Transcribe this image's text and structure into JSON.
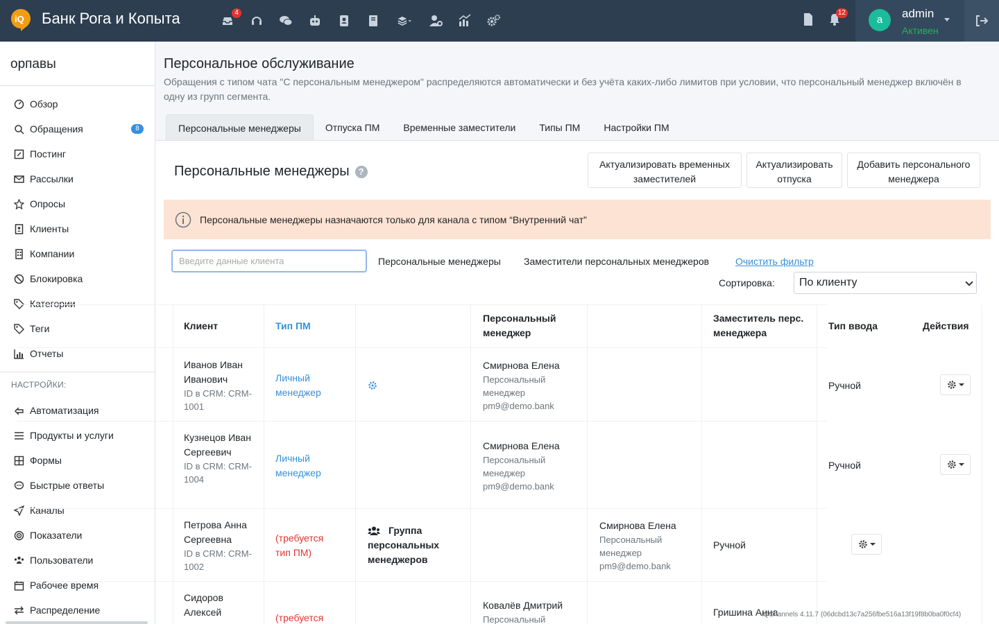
{
  "header": {
    "brand": "Банк Рога и Копыта",
    "inbox_badge": "4",
    "notif_badge": "12",
    "user": {
      "avatar_letter": "a",
      "name": "admin",
      "status": "Активен"
    }
  },
  "sidebar": {
    "title": "орпавы",
    "items": [
      {
        "label": "Обзор",
        "icon": "dashboard-icon"
      },
      {
        "label": "Обращения",
        "icon": "search-icon",
        "badge": "8"
      },
      {
        "label": "Постинг",
        "icon": "edit-icon"
      },
      {
        "label": "Рассылки",
        "icon": "envelope-icon"
      },
      {
        "label": "Опросы",
        "icon": "star-icon"
      },
      {
        "label": "Клиенты",
        "icon": "contact-book-icon"
      },
      {
        "label": "Компании",
        "icon": "building-icon"
      },
      {
        "label": "Блокировка",
        "icon": "ban-icon"
      },
      {
        "label": "Категории",
        "icon": "tags-icon"
      },
      {
        "label": "Теги",
        "icon": "tag-icon"
      },
      {
        "label": "Отчеты",
        "icon": "chart-icon"
      }
    ],
    "settings_title": "НАСТРОЙКИ:",
    "settings": [
      {
        "label": "Автоматизация",
        "icon": "automation-icon"
      },
      {
        "label": "Продукты и услуги",
        "icon": "list-icon"
      },
      {
        "label": "Формы",
        "icon": "table-icon"
      },
      {
        "label": "Быстрые ответы",
        "icon": "comment-icon"
      },
      {
        "label": "Каналы",
        "icon": "send-icon"
      },
      {
        "label": "Показатели",
        "icon": "target-icon"
      },
      {
        "label": "Пользователи",
        "icon": "users-icon"
      },
      {
        "label": "Рабочее время",
        "icon": "calendar-icon"
      },
      {
        "label": "Распределение",
        "icon": "exchange-icon"
      }
    ]
  },
  "page": {
    "title": "Персональное обслуживание",
    "description": "Обращения с типом чата \"С персональным менеджером\" распределяются автоматически и без учёта каких-либо лимитов при условии, что персональный менеджер включён в одну из групп сегмента.",
    "tabs": [
      "Персональные менеджеры",
      "Отпуска ПМ",
      "Временные заместители",
      "Типы ПМ",
      "Настройки ПМ"
    ],
    "card_title": "Персональные менеджеры",
    "buttons": {
      "update_deputies": "Актуализировать временных заместителей",
      "update_vacations": "Актуализировать отпуска",
      "add_manager": "Добавить персонального менеджера"
    },
    "alert": "Персональные менеджеры назначаются только для канала с типом “Внутренний чат”",
    "search_placeholder": "Введите данные клиента",
    "filters": {
      "managers": "Персональные менеджеры",
      "deputies": "Заместители персональных менеджеров",
      "clear": "Очистить фильтр"
    },
    "sort_label": "Сортировка:",
    "sort_value": "По клиенту"
  },
  "table": {
    "headers": {
      "client": "Клиент",
      "pm_type": "Тип ПМ",
      "manager": "Персональный менеджер",
      "deputy": "Заместитель перс. менеджера",
      "input_type": "Тип ввода",
      "actions": "Действия"
    },
    "rows": [
      {
        "client": "Иванов Иван Иванович",
        "crm": "ID в CRM: CRM-1001",
        "pm_type": "Личный менеджер",
        "manager_name": "Смирнова Елена",
        "manager_role": "Персональный менеджер",
        "manager_email": "pm9@demo.bank",
        "input_type": "Ручной"
      },
      {
        "client": "Кузнецов Иван Сергеевич",
        "crm": "ID в CRM: CRM-1004",
        "pm_type": "Личный менеджер",
        "manager_name": "Смирнова Елена",
        "manager_role": "Персональный менеджер",
        "manager_email": "pm9@demo.bank",
        "input_type": "Ручной"
      },
      {
        "client": "Петрова Анна Сергеевна",
        "crm": "ID в CRM: CRM-1002",
        "pm_type": "(требуется тип ПМ)",
        "group": "Группа персональных менеджеров",
        "manager_name": "Смирнова Елена",
        "manager_role": "Персональный менеджер",
        "manager_email": "pm9@demo.bank",
        "input_type": "Ручной"
      },
      {
        "client": "Сидоров Алексей",
        "pm_type": "(требуется",
        "manager_name": "Ковалёв Дмитрий",
        "manager_role": "Персональный",
        "deputy_name": "Гришина Анна"
      }
    ]
  },
  "footer": "iQChannels 4.11.7 (06dcbd13c7a256fbe516a13f19f8b0ba0f0cf4)"
}
